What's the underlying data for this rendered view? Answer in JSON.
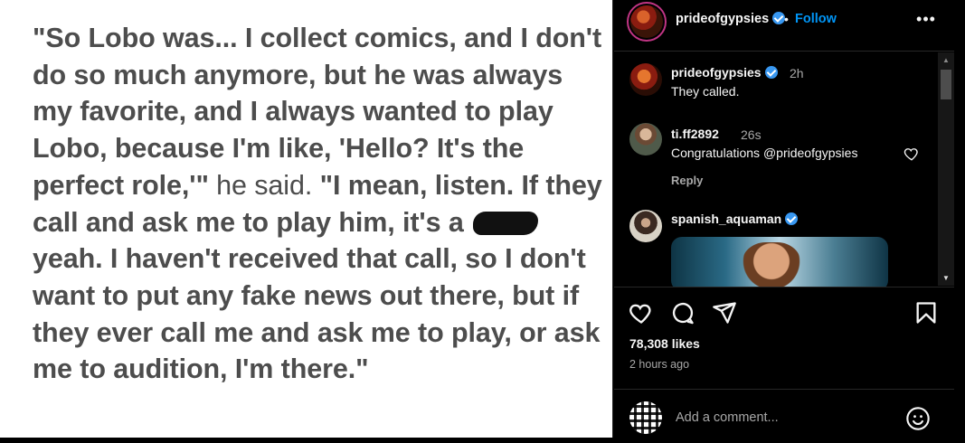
{
  "post_image": {
    "quote_parts": [
      "\"So Lobo was... I collect comics, and I don't do so much anymore, but he was always my favorite, and I always wanted to play Lobo, because I'm like, 'Hello? It's the perfect role,'\"",
      " he said. ",
      "\"I mean, listen. If they call and ask me to play him, it's a ",
      " yeah. I haven't received that call, so I don't want to put any fake news out there, but if they ever call me and ask me to play, or ask me to audition, I'm there.\""
    ]
  },
  "header": {
    "username": "prideofgypsies",
    "dot": "•",
    "follow_label": "Follow",
    "more_label": "•••"
  },
  "comments": [
    {
      "username": "prideofgypsies",
      "time": "2h",
      "text": "They called.",
      "verified": true
    },
    {
      "username": "ti.ff2892",
      "time": "26s",
      "text": "Congratulations @prideofgypsies",
      "reply_label": "Reply"
    },
    {
      "username": "spanish_aquaman",
      "verified": true
    }
  ],
  "scrollbar": {
    "up": "▲",
    "down": "▼"
  },
  "post_stats": {
    "likes": "78,308 likes",
    "time": "2 hours ago"
  },
  "add_comment": {
    "placeholder": "Add a comment..."
  },
  "icons": {
    "actions": [
      "heart-icon",
      "comment-icon",
      "share-icon",
      "bookmark-icon"
    ],
    "comment_heart": "heart-icon",
    "emoji": "emoji-icon",
    "more": "more-icon",
    "verified": "verified-badge-icon"
  },
  "colors": {
    "background": "#000000",
    "text_primary": "#f5f5f5",
    "text_secondary": "#a8a8a8",
    "follow_blue": "#0095f6",
    "verified_blue": "#3897f0",
    "divider": "#262626",
    "quote_text": "#4d4d4d"
  }
}
